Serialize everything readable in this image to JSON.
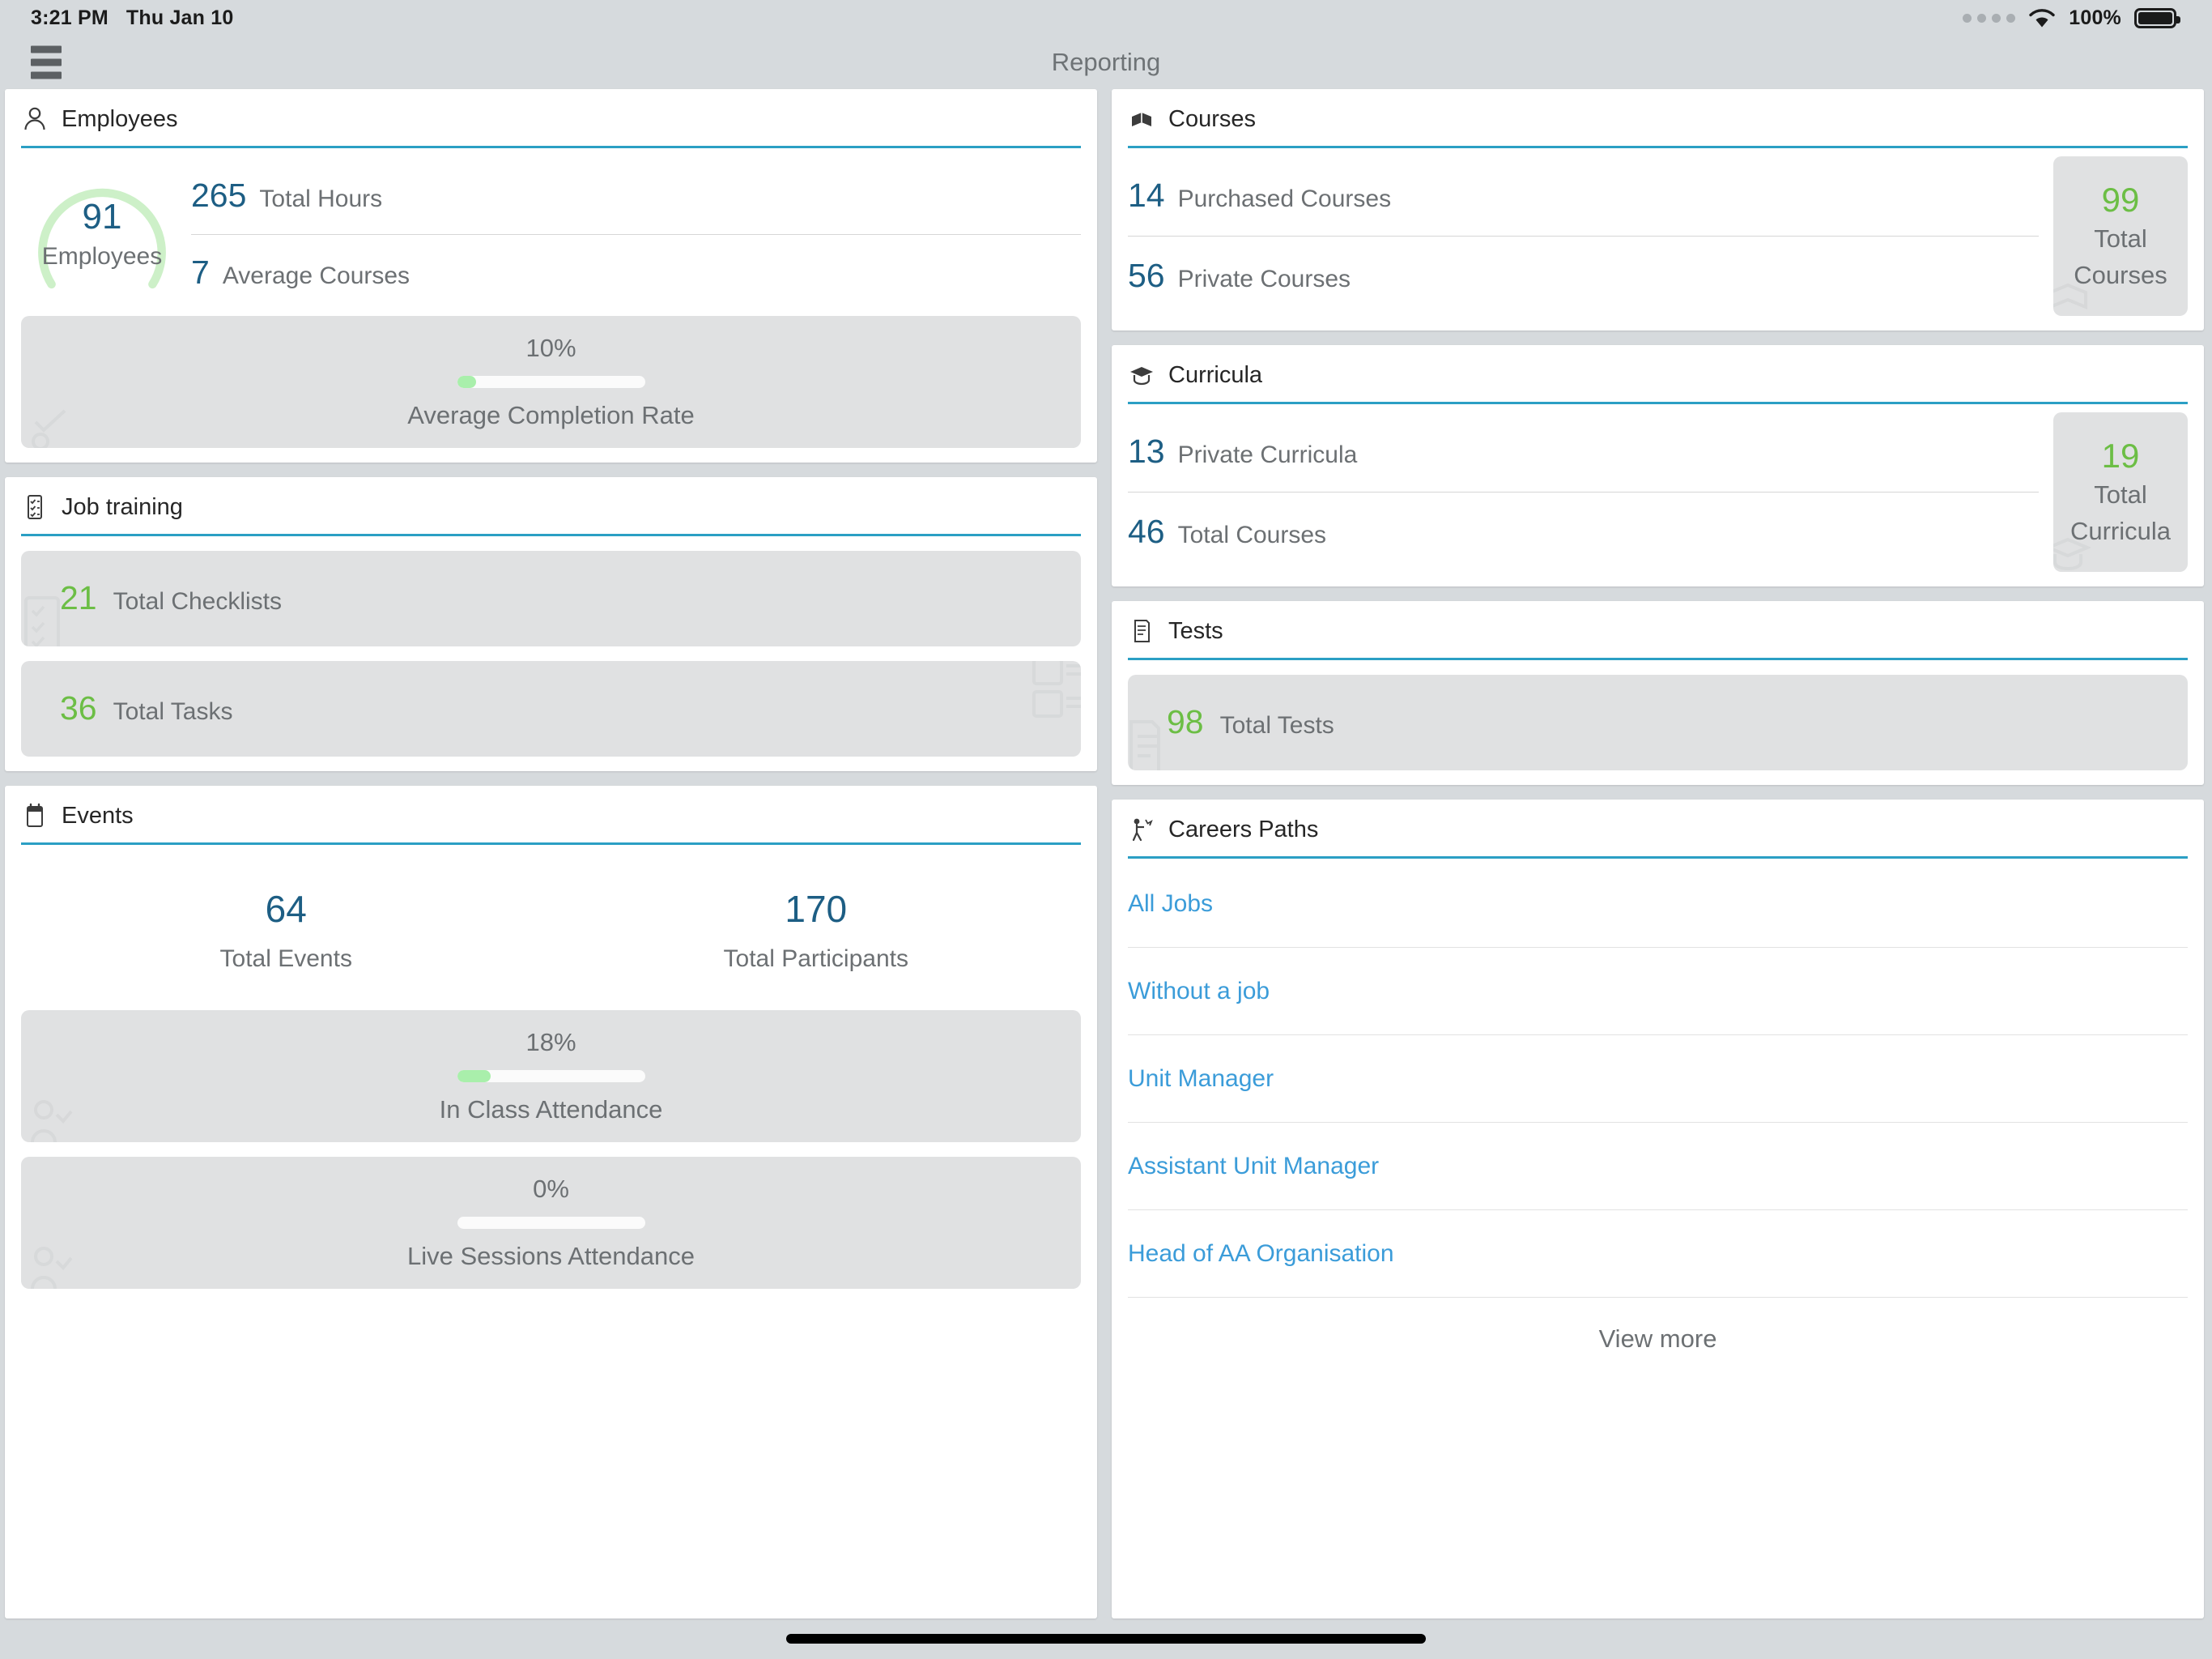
{
  "status_bar": {
    "time": "3:21 PM",
    "date": "Thu Jan 10",
    "battery_percent": "100%",
    "icons": [
      "signal-dots-icon",
      "wifi-icon",
      "battery-icon"
    ]
  },
  "navbar": {
    "menu_icon": "hamburger-menu-icon",
    "title": "Reporting"
  },
  "employees": {
    "title": "Employees",
    "icon": "person-icon",
    "gauge_value": "91",
    "gauge_label": "Employees",
    "stats": [
      {
        "value": "265",
        "label": "Total Hours"
      },
      {
        "value": "7",
        "label": "Average Courses"
      }
    ],
    "progress": {
      "percent_text": "10%",
      "percent_value": 10,
      "caption": "Average Completion Rate"
    }
  },
  "job_training": {
    "title": "Job training",
    "icon": "checklist-icon",
    "tiles": [
      {
        "value": "21",
        "label": "Total Checklists",
        "watermark": "checklist-icon"
      },
      {
        "value": "36",
        "label": "Total Tasks",
        "watermark": "tasks-icon"
      }
    ]
  },
  "events": {
    "title": "Events",
    "icon": "calendar-icon",
    "stats": [
      {
        "value": "64",
        "label": "Total Events"
      },
      {
        "value": "170",
        "label": "Total Participants"
      }
    ],
    "progress": [
      {
        "percent_text": "18%",
        "percent_value": 18,
        "caption": "In Class Attendance"
      },
      {
        "percent_text": "0%",
        "percent_value": 0,
        "caption": "Live Sessions Attendance"
      }
    ]
  },
  "courses": {
    "title": "Courses",
    "icon": "book-icon",
    "stats": [
      {
        "value": "14",
        "label": "Purchased Courses"
      },
      {
        "value": "56",
        "label": "Private Courses"
      }
    ],
    "total": {
      "value": "99",
      "label_line1": "Total",
      "label_line2": "Courses"
    }
  },
  "curricula": {
    "title": "Curricula",
    "icon": "graduation-cap-icon",
    "stats": [
      {
        "value": "13",
        "label": "Private Curricula"
      },
      {
        "value": "46",
        "label": "Total Courses"
      }
    ],
    "total": {
      "value": "19",
      "label_line1": "Total",
      "label_line2": "Curricula"
    }
  },
  "tests": {
    "title": "Tests",
    "icon": "test-paper-icon",
    "tile": {
      "value": "98",
      "label": "Total Tests",
      "watermark": "test-paper-icon"
    }
  },
  "careers_paths": {
    "title": "Careers Paths",
    "icon": "career-path-icon",
    "items": [
      "All Jobs",
      "Without a job",
      "Unit Manager",
      "Assistant Unit Manager",
      "Head of AA Organisation"
    ],
    "view_more": "View more"
  },
  "colors": {
    "accent_blue": "#2b9fc4",
    "link_blue": "#3b9cd9",
    "number_blue": "#1d5e84",
    "number_green": "#6cbe45",
    "progress_green": "#a9efab",
    "page_bg": "#d6dadd",
    "tile_bg": "#e0e1e2"
  }
}
